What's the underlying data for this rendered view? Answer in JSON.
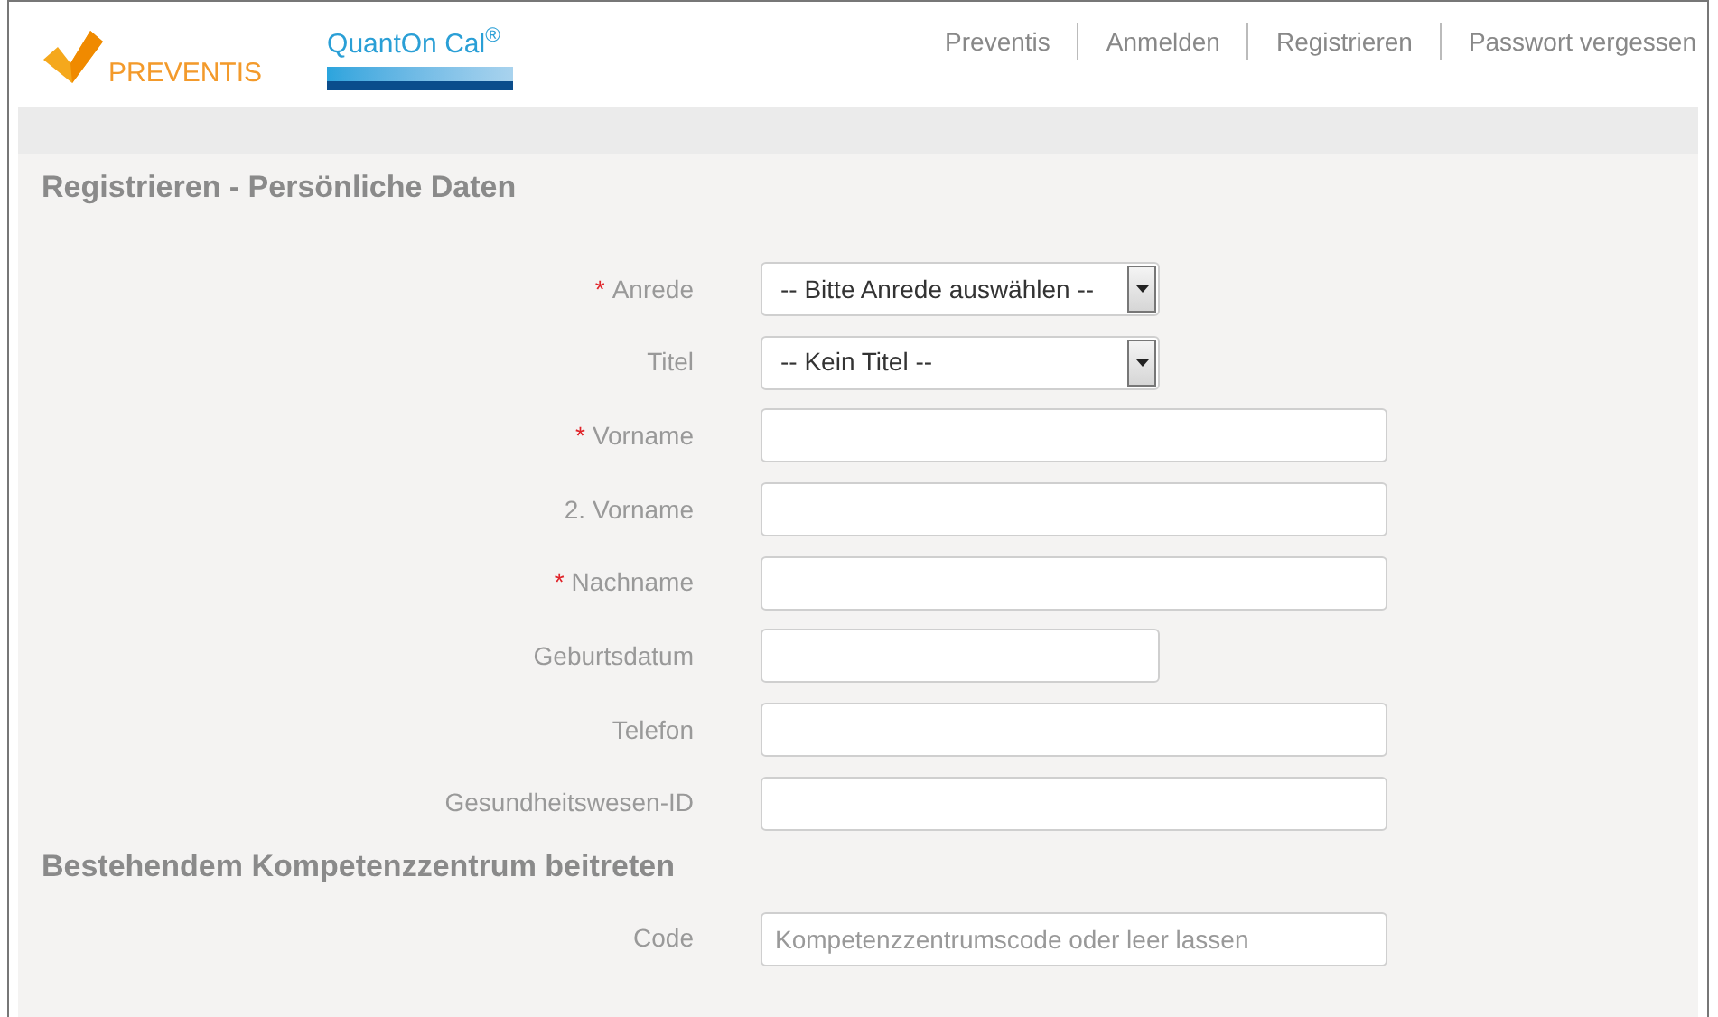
{
  "header": {
    "logo_text": "PREVENTIS",
    "product_logo": "QuantOn Cal$^{®}$",
    "nav": [
      "Preventis",
      "Anmelden",
      "Registrieren",
      "Passwort vergessen"
    ]
  },
  "sections": [
    {
      "title": "Registrieren - Persönliche Daten",
      "fields": [
        {
          "label": "Anrede",
          "marker": "*",
          "kind": "select",
          "value": "-- Bitte Anrede auswählen --"
        },
        {
          "label": "Titel",
          "kind": "select",
          "value": "-- Kein Titel --"
        },
        {
          "label": "Vorname",
          "marker": "*",
          "kind": "input"
        },
        {
          "label": "2. Vorname",
          "kind": "input"
        },
        {
          "label": "Nachname",
          "marker": "*",
          "kind": "input"
        },
        {
          "label": "Geburtsdatum",
          "kind": "short_input"
        },
        {
          "label": "Telefon",
          "kind": "input"
        },
        {
          "label": "Gesundheitswesen-ID",
          "kind": "input"
        }
      ]
    },
    {
      "title": "Bestehendem Kompetenzzentrum beitreten",
      "fields": [
        {
          "label": "Code",
          "kind": "input",
          "placeholder": "Kompetenzzentrumscode oder leer lassen"
        }
      ]
    }
  ]
}
